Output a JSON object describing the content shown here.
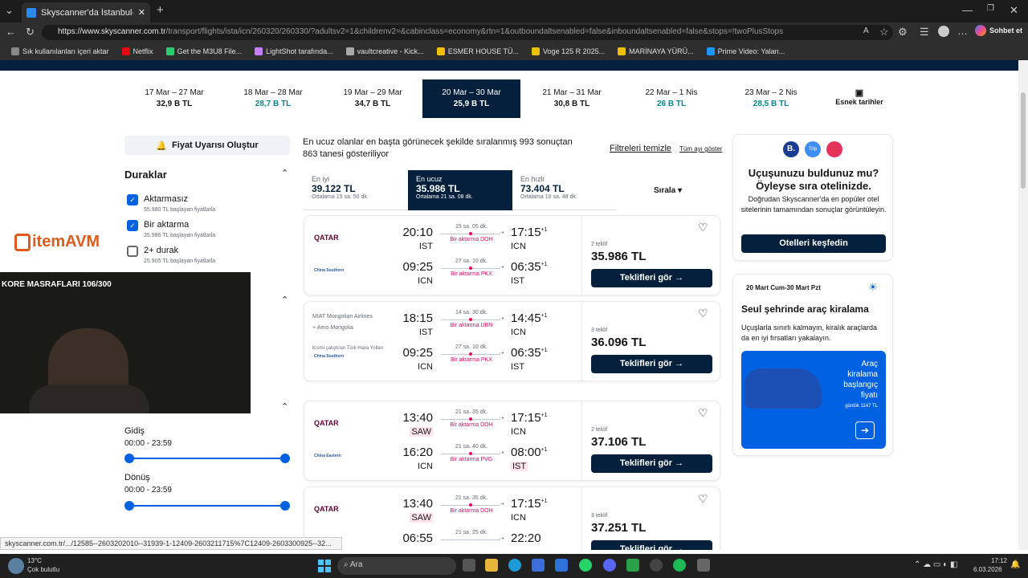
{
  "browser": {
    "tab_title": "Skyscanner'da İstanbul-Seul arası",
    "url_domain": "https://www.skyscanner.com.tr",
    "url_path": "/transport/flights/ista/icn/260320/260330/?adultsv2=1&childrenv2=&cabinclass=economy&rtn=1&outboundaltsenabled=false&inboundaltsenabled=false&stops=!twoPlusStops",
    "copilot_label": "Sohbet et",
    "bookmarks": [
      "Sık kullanılanları içeri aktar",
      "Netflix",
      "Get the M3U8 File...",
      "LightShot tarafında...",
      "vaultcreative - Kick...",
      "ESMER HOUSE TÜ...",
      "Voge 125 R 2025...",
      "MARİNAYA YÜRÜ...",
      "Prime Video: Yalan..."
    ],
    "status_url": "skyscanner.com.tr/.../12585--2603202010--31939-1-12409-2603211715%7C12409-2603300925--32..."
  },
  "date_bar": [
    {
      "range": "17 Mar – 27 Mar",
      "price": "32,9 B TL",
      "cheap": false
    },
    {
      "range": "18 Mar – 28 Mar",
      "price": "28,7 B TL",
      "cheap": true
    },
    {
      "range": "19 Mar – 29 Mar",
      "price": "34,7 B TL",
      "cheap": false
    },
    {
      "range": "20 Mar – 30 Mar",
      "price": "25,9 B TL",
      "cheap": false
    },
    {
      "range": "21 Mar – 31 Mar",
      "price": "30,8 B TL",
      "cheap": false
    },
    {
      "range": "22 Mar – 1 Nis",
      "price": "26 B TL",
      "cheap": true
    },
    {
      "range": "23 Mar – 2 Nis",
      "price": "28,5 B TL",
      "cheap": true
    }
  ],
  "flexible_dates": "Esnek tarihler",
  "sidebar": {
    "alert": "Fiyat Uyarısı Oluştur",
    "stops_title": "Duraklar",
    "stops": [
      {
        "label": "Aktarmasız",
        "sub": "55.980 TL başlayan fiyatlarla",
        "checked": true
      },
      {
        "label": "Bir aktarma",
        "sub": "35.986 TL başlayan fiyatlarla",
        "checked": true
      },
      {
        "label": "2+ durak",
        "sub": "25.905 TL başlayan fiyatlarla",
        "checked": false
      }
    ],
    "departure_label": "Gidiş",
    "departure_range": "00:00 - 23:59",
    "return_label": "Dönüş",
    "return_range": "00:00 - 23:59"
  },
  "results": {
    "summary": "En ucuz olanlar en başta görünecek şekilde sıralanmış 993 sonuçtan 863 tanesi gösteriliyor",
    "clear_filters": "Filtreleri temizle",
    "show_month": "Tüm ayı göster",
    "sort_tabs": [
      {
        "label": "En iyi",
        "price": "39.122 TL",
        "sub": "Ortalama 15 sa. 50 dk."
      },
      {
        "label": "En ucuz",
        "price": "35.986 TL",
        "sub": "Ortalama 21 sa. 08 dk."
      },
      {
        "label": "En hızlı",
        "price": "73.404 TL",
        "sub": "Ortalama 10 sa. 48 dk."
      }
    ],
    "sort_label": "Sırala",
    "cards": [
      {
        "legs": [
          {
            "airline": "QATAR",
            "dep": "20:10",
            "from": "IST",
            "dur": "15 sa. 05 dk.",
            "stop": "Bir aktarma DOH",
            "arr": "17:15",
            "plus": "+1",
            "to": "ICN"
          },
          {
            "airline": "China Southern",
            "dep": "09:25",
            "from": "ICN",
            "dur": "27 sa. 10 dk.",
            "stop": "Bir aktarma PKX",
            "arr": "06:35",
            "plus": "+1",
            "to": "IST"
          }
        ],
        "offers": "2 teklif",
        "price": "35.986 TL",
        "button": "Teklifleri gör →"
      },
      {
        "airline_text": "MIAT Mongolian Airlines + Aero Mongolia",
        "operated": "Kısmi çalıştıran Türk Hava Yolları",
        "legs": [
          {
            "airline": "",
            "dep": "18:15",
            "from": "IST",
            "dur": "14 sa. 30 dk.",
            "stop": "Bir aktarma UBN",
            "arr": "14:45",
            "plus": "+1",
            "to": "ICN"
          },
          {
            "airline": "China Southern",
            "dep": "09:25",
            "from": "ICN",
            "dur": "27 sa. 10 dk.",
            "stop": "Bir aktarma PKX",
            "arr": "06:35",
            "plus": "+1",
            "to": "IST"
          }
        ],
        "offers": "3 teklif",
        "price": "36.096 TL",
        "button": "Teklifleri gör →"
      },
      {
        "legs": [
          {
            "airline": "QATAR",
            "dep": "13:40",
            "from": "SAW",
            "dur": "21 sa. 35 dk.",
            "stop": "Bir aktarma DOH",
            "arr": "17:15",
            "plus": "+1",
            "to": "ICN"
          },
          {
            "airline": "China Eastern",
            "dep": "16:20",
            "from": "ICN",
            "dur": "21 sa. 40 dk.",
            "stop": "Bir aktarma PVG",
            "arr": "08:00",
            "plus": "+1",
            "to": "IST"
          }
        ],
        "offers": "2 teklif",
        "price": "37.106 TL",
        "button": "Teklifleri gör →"
      },
      {
        "legs": [
          {
            "airline": "QATAR",
            "dep": "13:40",
            "from": "SAW",
            "dur": "21 sa. 35 dk.",
            "stop": "Bir aktarma DOH",
            "arr": "17:15",
            "plus": "+1",
            "to": "ICN"
          },
          {
            "airline": "",
            "dep": "06:55",
            "from": "",
            "dur": "21 sa. 25 dk.",
            "stop": "",
            "arr": "22:20",
            "plus": "",
            "to": ""
          }
        ],
        "offers": "3 teklif",
        "price": "37.251 TL",
        "button": "Teklifleri gör →"
      }
    ]
  },
  "hotel_ad": {
    "logos": [
      "B.",
      "Trip"
    ],
    "title": "Uçuşunuzu buldunuz mu? Öyleyse sıra otelinizde.",
    "text": "Doğrudan Skyscanner'da en popüler otel sitelerinin tamamından sonuçlar görüntüleyin.",
    "button": "Otelleri keşfedin"
  },
  "car_ad": {
    "dates": "20 Mart Cum-30 Mart Pzt",
    "title": "Seul şehrinde araç kiralama",
    "text": "Uçuşlarla sınırlı kalmayın, kiralık araçlarda da en iyi fırsatları yakalayın.",
    "banner": "Araç kiralama başlangıç fiyatı",
    "banner_price": "günlük 1147 TL"
  },
  "overlay": {
    "logo": "itemAVM",
    "stream_text": "KORE MASRAFLARI 106/300"
  },
  "taskbar": {
    "temp": "13°C",
    "weather": "Çok bulutlu",
    "search": "Ara",
    "time": "17:12",
    "date": "6.03.2026"
  }
}
